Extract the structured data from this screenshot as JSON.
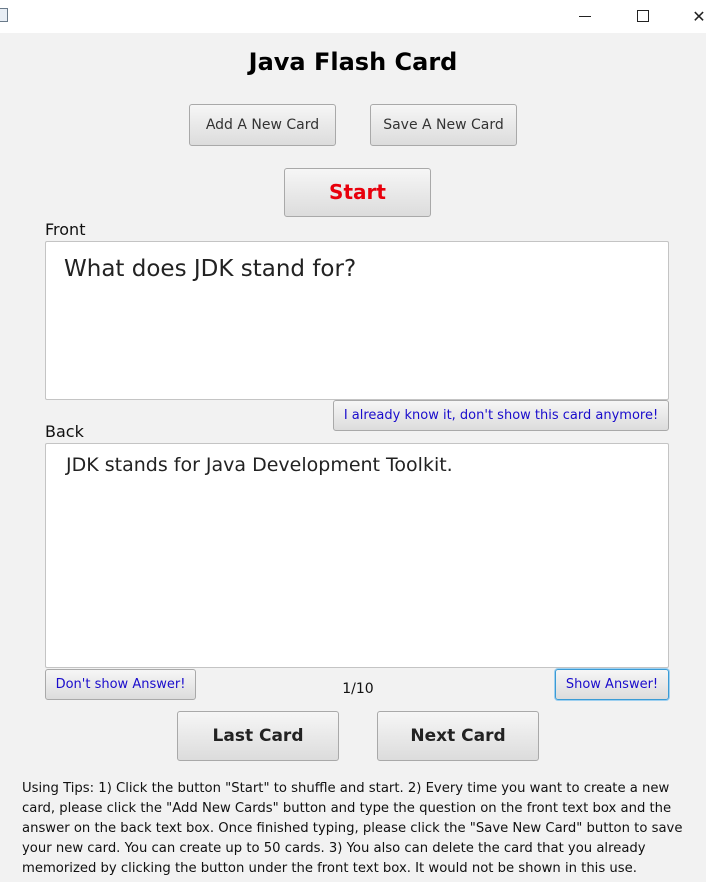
{
  "window": {
    "minimize_glyph": "",
    "maximize_glyph": "",
    "close_glyph": "✕"
  },
  "header": {
    "title": "Java Flash Card"
  },
  "toolbar": {
    "add_label": "Add A New Card",
    "save_label": "Save A New Card",
    "start_label": "Start"
  },
  "front": {
    "label": "Front",
    "text": "What does JDK stand for?",
    "know_button": "I already know it, don't show this card anymore!"
  },
  "back": {
    "label": "Back",
    "text": "JDK stands for Java Development Toolkit.",
    "hide_button": "Don't show Answer!",
    "show_button": "Show Answer!"
  },
  "navigation": {
    "counter": "1/10",
    "last_label": "Last Card",
    "next_label": "Next Card"
  },
  "tips": {
    "text": "Using Tips: 1) Click the button \"Start\" to shuffle and start.   2) Every time you want to create a new card, please click the \"Add New Cards\" button and type the question on the front text box and the answer on the back text box. Once finished typing, please click the \"Save New Card\" button to save your new card.  You can create up to 50 cards. 3) You also can delete the card that you already memorized by clicking the button under the front text box. It would not be shown in this use."
  },
  "colors": {
    "start_text": "#e8000c",
    "link_blue": "#1a0ccc",
    "focus_border": "#3a9bd5"
  }
}
